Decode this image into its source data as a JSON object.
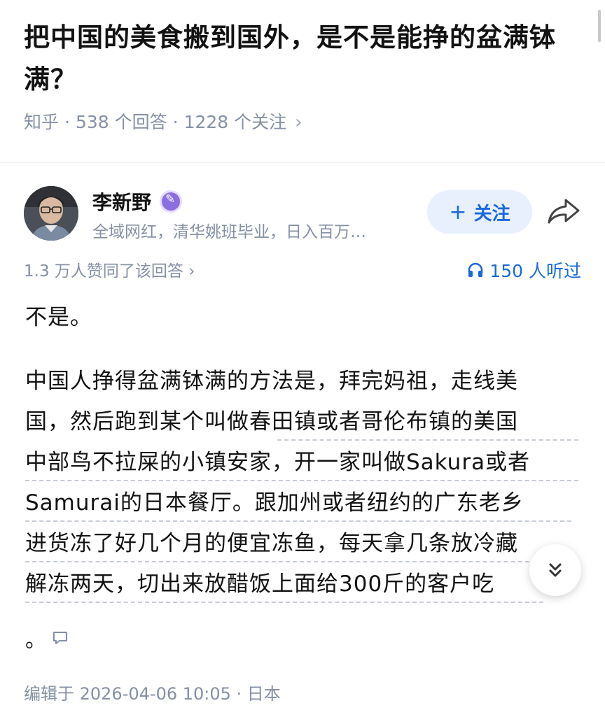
{
  "question": {
    "title": "把中国的美食搬到国外，是不是能挣的盆满钵满？",
    "source": "知乎",
    "answers_count": "538 个回答",
    "followers_count": "1228 个关注",
    "chevron": "›"
  },
  "author": {
    "name": "李新野",
    "bio": "全域网红，清华姚班毕业，日入百万…",
    "follow_label": "关注",
    "follow_plus": "+"
  },
  "stats": {
    "agree_text": "1.3 万人赞同了该回答 ›",
    "listen_text": "150 人听过"
  },
  "answer": {
    "paragraph1": "不是。",
    "lines": [
      "中国人挣得盆满钵满的方法是，拜完妈祖，走线美",
      "国，然后跑到某个叫做春田镇或者哥伦布镇的美国",
      "中部鸟不拉屎的小镇安家，开一家叫做Sakura或者",
      "Samurai的日本餐厅。跟加州或者纽约的广东老乡",
      "进货冻了好几个月的便宜冻鱼，每天拿几条放冷藏",
      "解冻两天，切出来放醋饭上面给300斤的客户吃"
    ],
    "tail": "。"
  },
  "footer": {
    "edited": "编辑于 2026-04-06 10:05 · 日本"
  },
  "icons": {
    "badge": "pen-badge-icon",
    "share": "share-arrow-icon",
    "headphones": "headphones-icon",
    "comment": "comment-icon",
    "expand": "double-chevron-down-icon"
  },
  "colors": {
    "accent": "#1769e0",
    "muted": "#8590a6",
    "badge": "#8b6fe0"
  }
}
